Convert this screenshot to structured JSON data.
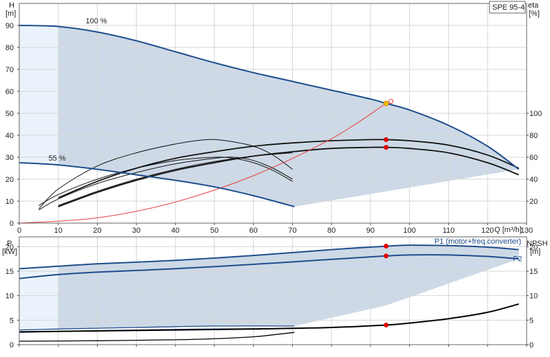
{
  "chart_data": [
    {
      "type": "line",
      "model_label": "SPE 95-4",
      "xlabel": "Q [m³/h]",
      "ylabel_left": "H",
      "ylabel_left_unit": "[m]",
      "ylabel_right": "eta",
      "ylabel_right_unit": "[%]",
      "xlim": [
        0,
        130
      ],
      "ylim": [
        0,
        100
      ],
      "x_ticks": [
        "0",
        "10",
        "20",
        "30",
        "40",
        "50",
        "60",
        "70",
        "80",
        "90",
        "100",
        "110",
        "120",
        "130"
      ],
      "y_ticks_left": [
        "0",
        "10",
        "20",
        "30",
        "40",
        "50",
        "60",
        "70",
        "80",
        "90"
      ],
      "y_ticks_right": [
        "20",
        "40",
        "60",
        "80",
        "100"
      ],
      "grid": true,
      "series": [
        {
          "name": "100 %",
          "color": "#1e4d8c",
          "x": [
            0,
            10,
            20,
            30,
            40,
            50,
            60,
            70,
            80,
            90,
            94,
            100,
            110,
            120,
            128
          ],
          "y": [
            90,
            89.5,
            87,
            83,
            78,
            73,
            68.5,
            64.5,
            60.5,
            56.5,
            54.5,
            51.5,
            44.5,
            35,
            24.5
          ]
        },
        {
          "name": "55 %",
          "color": "#1e4d8c",
          "x": [
            0,
            10,
            20,
            30,
            40,
            50,
            60,
            70.5
          ],
          "y": [
            27.5,
            26.5,
            24.5,
            22,
            19.5,
            16.5,
            12.5,
            7.5
          ]
        }
      ],
      "system_curve": {
        "color": "#e83b3b",
        "x": [
          0,
          20,
          40,
          60,
          80,
          94
        ],
        "y": [
          0,
          2.4,
          9.6,
          21.6,
          38.4,
          54.5
        ]
      },
      "eta_curves": [
        {
          "x": [
            10,
            20,
            30,
            40,
            50,
            60,
            70,
            80,
            90,
            94,
            100,
            110,
            120,
            128
          ],
          "y": [
            11.5,
            19,
            25,
            29.5,
            32.5,
            35,
            36.5,
            37.5,
            38,
            38,
            37.5,
            35.5,
            31,
            25
          ]
        },
        {
          "x": [
            10,
            20,
            30,
            40,
            50,
            60,
            70,
            80,
            90,
            94,
            100,
            110,
            120,
            128
          ],
          "y": [
            7.5,
            14,
            19.5,
            24,
            27.5,
            30.5,
            32.5,
            34,
            34.5,
            34.5,
            34,
            32,
            27.5,
            22
          ]
        },
        {
          "x": [
            10,
            20,
            30,
            40,
            50,
            60,
            70
          ],
          "y": [
            8,
            14.5,
            20,
            24.5,
            28,
            30.5,
            32
          ]
        },
        {
          "x": [
            5,
            10,
            20,
            30,
            40,
            50,
            55,
            60,
            65,
            70
          ],
          "y": [
            8,
            13,
            20,
            25,
            28.5,
            30,
            29.5,
            27.5,
            24,
            19
          ]
        },
        {
          "x": [
            5,
            10,
            20,
            30,
            40,
            50,
            55,
            60,
            65,
            70
          ],
          "y": [
            6,
            11,
            18,
            23,
            27,
            29.5,
            30,
            28.5,
            25,
            20
          ]
        },
        {
          "x": [
            5,
            10,
            20,
            30,
            40,
            48,
            53,
            60,
            65,
            70
          ],
          "y": [
            6.5,
            15.5,
            26,
            32,
            36,
            38,
            37.5,
            35,
            31,
            24.5
          ]
        }
      ],
      "duty_point": {
        "x": 94,
        "y": 54.5,
        "color": "#f5b800"
      },
      "red_points": [
        {
          "x": 94,
          "y": 38
        },
        {
          "x": 94,
          "y": 34.5
        }
      ]
    },
    {
      "type": "line",
      "xlabel": "",
      "ylabel_left": "P",
      "ylabel_left_unit": "[kW]",
      "ylabel_right": "NPSH",
      "ylabel_right_unit": "[m]",
      "xlim": [
        0,
        130
      ],
      "ylim": [
        0,
        22
      ],
      "y_ticks_left": [
        "0",
        "5",
        "10",
        "15",
        "20"
      ],
      "y_ticks_right": [
        "0",
        "5",
        "10",
        "15",
        "20"
      ],
      "grid": true,
      "series": [
        {
          "name": "P1 (motor+freq.converter)",
          "color": "#1e4d8c",
          "x": [
            0,
            10,
            20,
            40,
            60,
            80,
            94,
            100,
            110,
            120,
            128
          ],
          "y": [
            15.5,
            16,
            16.5,
            17.2,
            18.2,
            19.4,
            20.1,
            20.3,
            20.2,
            19.9,
            19.4
          ]
        },
        {
          "name": "P2",
          "color": "#1e4d8c",
          "x": [
            0,
            10,
            20,
            40,
            60,
            80,
            94,
            100,
            110,
            120,
            128
          ],
          "y": [
            13.5,
            14.3,
            14.8,
            15.5,
            16.4,
            17.4,
            18.1,
            18.3,
            18.3,
            18,
            17.5
          ]
        },
        {
          "name": "NPSH",
          "color": "#000000",
          "x": [
            0,
            40,
            60,
            80,
            94,
            100,
            110,
            120,
            128
          ],
          "y": [
            2.6,
            3.0,
            3.2,
            3.5,
            4.0,
            4.4,
            5.3,
            6.6,
            8.3
          ]
        }
      ],
      "low_speed_lines": [
        {
          "color": "#1e4d8c",
          "x": [
            0,
            10,
            30,
            50,
            70.5
          ],
          "y": [
            3.0,
            3.2,
            3.5,
            3.8,
            3.8
          ]
        },
        {
          "color": "#1e4d8c",
          "x": [
            0,
            10,
            30,
            50,
            70.5
          ],
          "y": [
            2.5,
            2.7,
            3.0,
            3.2,
            3.3
          ]
        },
        {
          "color": "#000000",
          "x": [
            0,
            20,
            40,
            50,
            60,
            65,
            70.5
          ],
          "y": [
            0.7,
            0.8,
            1.0,
            1.2,
            1.6,
            2.0,
            2.5
          ]
        }
      ],
      "red_points": [
        {
          "x": 94,
          "y": 20.1
        },
        {
          "x": 94,
          "y": 18.1
        },
        {
          "x": 94,
          "y": 4.0
        }
      ]
    }
  ]
}
